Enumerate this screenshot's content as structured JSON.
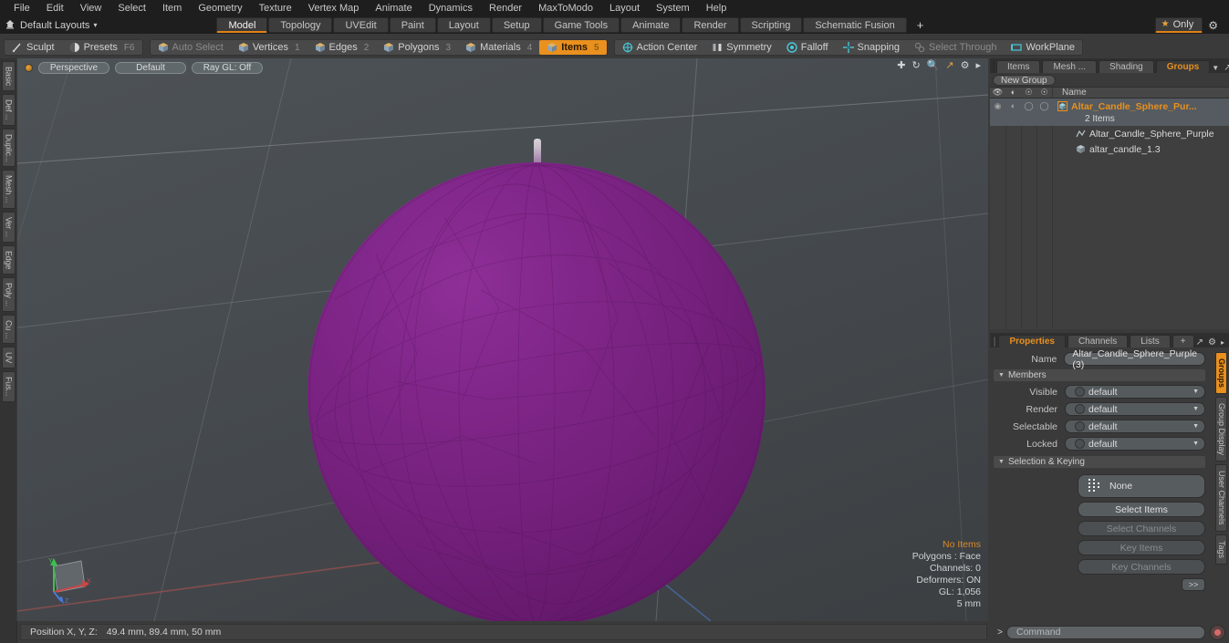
{
  "menu": {
    "items": [
      "File",
      "Edit",
      "View",
      "Select",
      "Item",
      "Geometry",
      "Texture",
      "Vertex Map",
      "Animate",
      "Dynamics",
      "Render",
      "MaxToModo",
      "Layout",
      "System",
      "Help"
    ]
  },
  "layoutbar": {
    "home_icon": "home-icon",
    "label": "Default Layouts",
    "caret": "▾",
    "tabs": [
      {
        "label": "Model",
        "active": true
      },
      {
        "label": "Topology",
        "active": false
      },
      {
        "label": "UVEdit",
        "active": false
      },
      {
        "label": "Paint",
        "active": false
      },
      {
        "label": "Layout",
        "active": false
      },
      {
        "label": "Setup",
        "active": false
      },
      {
        "label": "Game Tools",
        "active": false
      },
      {
        "label": "Animate",
        "active": false
      },
      {
        "label": "Render",
        "active": false
      },
      {
        "label": "Scripting",
        "active": false
      },
      {
        "label": "Schematic Fusion",
        "active": false
      }
    ],
    "plus": "+",
    "only_label": "Only",
    "star_icon": "star-icon",
    "gear_icon": "gear-icon"
  },
  "modebar": {
    "group1": [
      {
        "label": "Sculpt",
        "icon": "brush-icon",
        "state": "normal",
        "num": ""
      },
      {
        "label": "Presets",
        "icon": "sphere-icon",
        "state": "normal",
        "num": "F6"
      }
    ],
    "group2": [
      {
        "label": "Auto Select",
        "icon": "cube-icon",
        "state": "dim",
        "num": ""
      },
      {
        "label": "Vertices",
        "icon": "cube-icon",
        "state": "normal",
        "num": "1"
      },
      {
        "label": "Edges",
        "icon": "cube-icon",
        "state": "normal",
        "num": "2"
      },
      {
        "label": "Polygons",
        "icon": "cube-icon",
        "state": "normal",
        "num": "3"
      },
      {
        "label": "Materials",
        "icon": "cube-icon",
        "state": "normal",
        "num": "4"
      },
      {
        "label": "Items",
        "icon": "cube-icon",
        "state": "on",
        "num": "5"
      }
    ],
    "group3": [
      {
        "label": "Action Center",
        "icon": "target-icon",
        "state": "normal",
        "num": ""
      },
      {
        "label": "Symmetry",
        "icon": "mirror-icon",
        "state": "normal",
        "num": ""
      },
      {
        "label": "Falloff",
        "icon": "falloff-icon",
        "state": "normal",
        "num": ""
      },
      {
        "label": "Snapping",
        "icon": "snap-icon",
        "state": "normal",
        "num": ""
      },
      {
        "label": "Select Through",
        "icon": "through-icon",
        "state": "dim",
        "num": ""
      },
      {
        "label": "WorkPlane",
        "icon": "workplane-icon",
        "state": "normal",
        "num": ""
      }
    ]
  },
  "left_tabs": [
    "Basic",
    "Def ...",
    "Duplic...",
    "Mesh ...",
    "Ver ...",
    "Edge",
    "Poly ...",
    "Cu ...",
    "UV",
    "Fus..."
  ],
  "viewport": {
    "pills": [
      "Perspective",
      "Default",
      "Ray GL: Off"
    ],
    "tool_icons": [
      "move-icon",
      "rotate-icon",
      "zoom-icon",
      "fullscreen-icon",
      "gear-icon",
      "arrow-right-icon"
    ],
    "stats": [
      {
        "text": "No Items",
        "warn": true
      },
      {
        "text": "Polygons : Face",
        "warn": false
      },
      {
        "text": "Channels: 0",
        "warn": false
      },
      {
        "text": "Deformers: ON",
        "warn": false
      },
      {
        "text": "GL: 1,056",
        "warn": false
      },
      {
        "text": "5 mm",
        "warn": false
      }
    ],
    "gizmo": {
      "x": "X",
      "y": "Y",
      "z": "Z"
    },
    "object_color": "#7d2787",
    "wick_color": "#d8d2d8"
  },
  "right_panel": {
    "top_tabs": [
      {
        "label": "Items",
        "active": false
      },
      {
        "label": "Mesh ...",
        "active": false
      },
      {
        "label": "Shading",
        "active": false
      },
      {
        "label": "Groups",
        "active": true
      }
    ],
    "new_group_button": "New Group",
    "list_columns": [
      "eye-icon",
      "render-icon",
      "selectable-icon",
      "lock-icon"
    ],
    "name_column": "Name",
    "rows": [
      {
        "label": "Altar_Candle_Sphere_Pur...",
        "type": "group",
        "selected": true,
        "icon": "group-icon",
        "sub": "2 Items"
      },
      {
        "label": "Altar_Candle_Sphere_Purple",
        "type": "child",
        "selected": false,
        "icon": "mesh-icon"
      },
      {
        "label": "altar_candle_1.3",
        "type": "child",
        "selected": false,
        "icon": "item-icon"
      }
    ]
  },
  "properties": {
    "tabs": [
      {
        "label": "Properties",
        "active": true
      },
      {
        "label": "Channels",
        "active": false
      },
      {
        "label": "Lists",
        "active": false
      }
    ],
    "plus": "+",
    "name_label": "Name",
    "name_value": "Altar_Candle_Sphere_Purple (3)",
    "members_section": "Members",
    "fields": [
      {
        "label": "Visible",
        "value": "default"
      },
      {
        "label": "Render",
        "value": "default"
      },
      {
        "label": "Selectable",
        "value": "default"
      },
      {
        "label": "Locked",
        "value": "default"
      }
    ],
    "selection_section": "Selection & Keying",
    "buttons": [
      {
        "label": "None",
        "enabled": true,
        "big": true
      },
      {
        "label": "Select Items",
        "enabled": true,
        "big": false
      },
      {
        "label": "Select Channels",
        "enabled": false,
        "big": false
      },
      {
        "label": "Key Items",
        "enabled": false,
        "big": false
      },
      {
        "label": "Key Channels",
        "enabled": false,
        "big": false
      }
    ],
    "expand_button": ">>"
  },
  "right_tabs": [
    {
      "label": "Groups",
      "active": true
    },
    {
      "label": "Group Display",
      "active": false
    },
    {
      "label": "User Channels",
      "active": false
    },
    {
      "label": "Tags",
      "active": false
    }
  ],
  "statusbar": {
    "position_label": "Position X, Y, Z:",
    "position_value": "49.4 mm, 89.4 mm, 50 mm"
  },
  "commandbar": {
    "prompt": ">",
    "placeholder": "Command",
    "record_icon": "record-icon"
  },
  "colors": {
    "accent": "#e9901e",
    "object": "#7d2787",
    "panel": "#3a3a3a",
    "dark": "#1e1e1e"
  }
}
